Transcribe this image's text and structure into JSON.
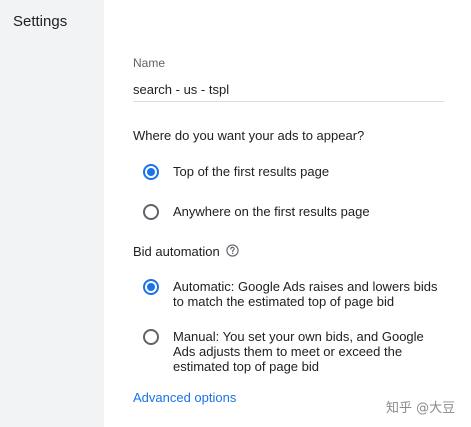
{
  "settings": {
    "title": "Settings"
  },
  "name_field": {
    "label": "Name",
    "value": "search - us - tspl"
  },
  "ad_placement": {
    "question": "Where do you want your ads to appear?",
    "options": [
      {
        "label": "Top of the first results page",
        "selected": true
      },
      {
        "label": "Anywhere on the first results page",
        "selected": false
      }
    ]
  },
  "bid_automation": {
    "heading": "Bid automation",
    "help_icon": "question-circle-icon",
    "options": [
      {
        "label": "Automatic: Google Ads raises and lowers bids to match the estimated top of page bid",
        "selected": true
      },
      {
        "label": "Manual: You set your own bids, and Google Ads adjusts them to meet or exceed the estimated top of page bid",
        "selected": false
      }
    ]
  },
  "advanced": {
    "label": "Advanced options"
  },
  "watermark": {
    "text": "知乎 @大豆"
  },
  "colors": {
    "accent": "#1a73e8",
    "side_panel": "#f1f3f4",
    "text": "#202124",
    "muted": "#5f6368"
  }
}
